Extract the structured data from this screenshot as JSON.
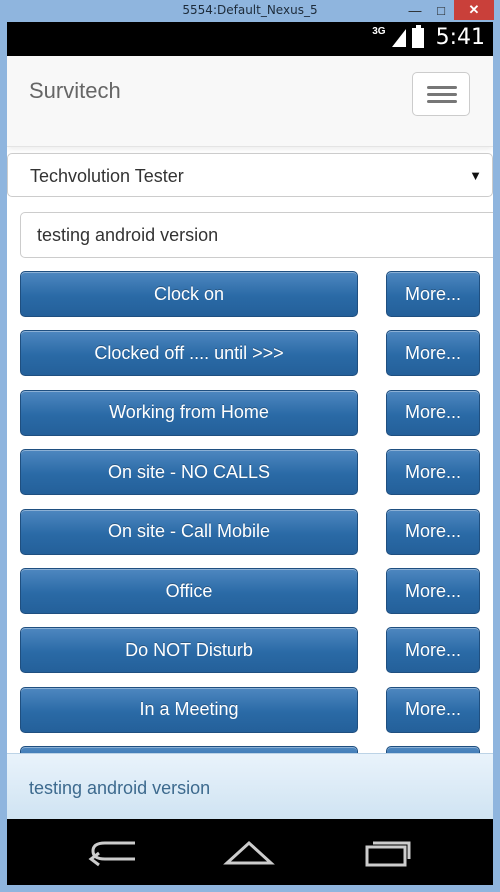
{
  "window": {
    "title": "5554:Default_Nexus_5",
    "minimize": "—",
    "maximize": "□",
    "close": "✕"
  },
  "status_bar": {
    "network": "3G",
    "time": "5:41"
  },
  "app_bar": {
    "brand": "Survitech",
    "menu_icon": "hamburger-icon"
  },
  "user_select": {
    "value": "Techvolution Tester",
    "arrow": "▼"
  },
  "status_message": {
    "value": "testing android version"
  },
  "status_buttons": [
    {
      "label": "Clock on",
      "more": "More..."
    },
    {
      "label": "Clocked off .... until >>>",
      "more": "More..."
    },
    {
      "label": "Working from Home",
      "more": "More..."
    },
    {
      "label": "On site - NO CALLS",
      "more": "More..."
    },
    {
      "label": "On site - Call Mobile",
      "more": "More..."
    },
    {
      "label": "Office",
      "more": "More..."
    },
    {
      "label": "Do NOT Disturb",
      "more": "More..."
    },
    {
      "label": "In a Meeting",
      "more": "More..."
    },
    {
      "label": "",
      "more": ""
    }
  ],
  "footer": {
    "text": "testing android version"
  },
  "nav_bar": {
    "back_icon": "back-icon",
    "home_icon": "home-icon",
    "recents_icon": "recents-icon"
  }
}
